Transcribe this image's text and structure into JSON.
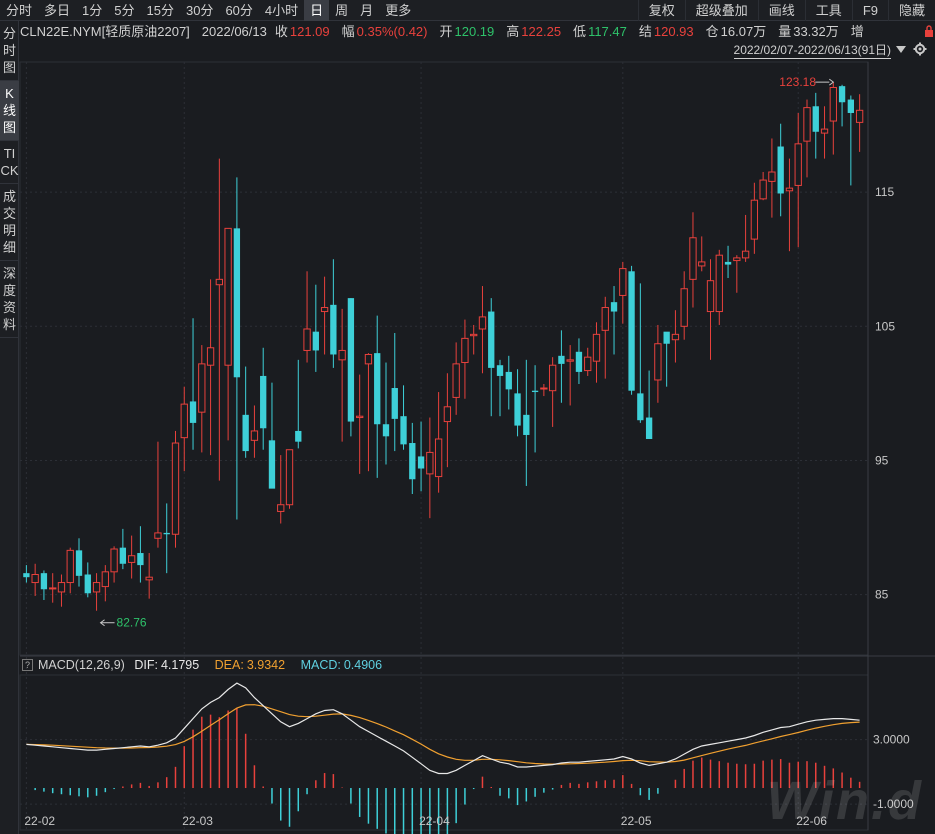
{
  "toolbar": {
    "periods": [
      "分时",
      "多日",
      "1分",
      "5分",
      "15分",
      "30分",
      "60分",
      "4小时",
      "日",
      "周",
      "月",
      "更多"
    ],
    "active_period": "日",
    "right_buttons": [
      "复权",
      "超级叠加",
      "画线",
      "工具",
      "F9",
      "隐藏"
    ]
  },
  "side_tabs": [
    {
      "label": "分时图",
      "active": false
    },
    {
      "label": "K线图",
      "active": true
    },
    {
      "label": "TICK",
      "active": false
    },
    {
      "label": "成交明细",
      "active": false
    },
    {
      "label": "深度资料",
      "active": false
    }
  ],
  "info": {
    "symbol": "CLN22E.NYM[轻质原油2207]",
    "date": "2022/06/13",
    "close_label": "收",
    "close": "121.09",
    "change_label": "幅",
    "change": "0.35%(0.42)",
    "open_label": "开",
    "open": "120.19",
    "high_label": "高",
    "high": "122.25",
    "low_label": "低",
    "low": "117.47",
    "settle_label": "结",
    "settle": "120.93",
    "oi_label": "仓",
    "oi": "16.07万",
    "vol_label": "量",
    "vol": "33.32万",
    "inc_label": "增"
  },
  "date_range": "2022/02/07-2022/06/13(91日)",
  "macd": {
    "title": "MACD(12,26,9)",
    "dif_label": "DIF:",
    "dif": "4.1795",
    "dea_label": "DEA:",
    "dea": "3.9342",
    "macd_label": "MACD:",
    "macd": "0.4906"
  },
  "watermark": "Win.d",
  "colors": {
    "up": "#e8413c",
    "down": "#3ed0d8",
    "dif": "#e8e8e8",
    "dea": "#f0a030",
    "bg": "#1a1c20",
    "grid": "#2c2f36"
  },
  "chart_data": {
    "type": "candlestick",
    "price_axis_ticks": [
      85,
      95,
      105,
      115
    ],
    "price_range": [
      80.5,
      124.7
    ],
    "max_label": "123.18",
    "min_label": "82.76",
    "macd_axis_ticks": [
      "3.0000",
      "-1.0000"
    ],
    "date_ticks": [
      {
        "label": "22-02",
        "index": 0
      },
      {
        "label": "22-03",
        "index": 18
      },
      {
        "label": "22-04",
        "index": 45
      },
      {
        "label": "22-05",
        "index": 68
      },
      {
        "label": "22-06",
        "index": 88
      }
    ],
    "candles": [
      [
        86.6,
        87.2,
        85.9,
        86.3
      ],
      [
        85.9,
        87.3,
        84.9,
        86.5
      ],
      [
        86.6,
        86.8,
        84.6,
        85.4
      ],
      [
        85.5,
        86.6,
        84.4,
        85.5
      ],
      [
        85.2,
        86.5,
        84.1,
        85.9
      ],
      [
        85.9,
        88.5,
        85.1,
        88.3
      ],
      [
        88.3,
        89.2,
        85.6,
        86.4
      ],
      [
        86.5,
        87.4,
        84.8,
        85.1
      ],
      [
        85.2,
        86.6,
        83.8,
        85.9
      ],
      [
        85.6,
        87.2,
        84.5,
        86.7
      ],
      [
        86.7,
        88.6,
        85.9,
        88.4
      ],
      [
        88.5,
        89.9,
        86.9,
        87.3
      ],
      [
        87.4,
        89.4,
        86.2,
        87.9
      ],
      [
        88.1,
        90.1,
        85.9,
        87.2
      ],
      [
        86.1,
        88.1,
        84.7,
        86.3
      ],
      [
        89.2,
        96.4,
        88.5,
        89.6
      ],
      [
        89.6,
        91.8,
        86.6,
        89.5
      ],
      [
        89.5,
        97.2,
        88.5,
        96.3
      ],
      [
        96.7,
        100.5,
        94.2,
        99.2
      ],
      [
        99.4,
        105.6,
        95.8,
        97.8
      ],
      [
        98.6,
        103.6,
        95.6,
        102.2
      ],
      [
        102.1,
        108.5,
        95.4,
        103.4
      ],
      [
        108.1,
        117.5,
        93.5,
        108.5
      ],
      [
        102.1,
        112.3,
        96.5,
        112.3
      ],
      [
        112.3,
        116.1,
        90.6,
        101.2
      ],
      [
        98.4,
        102.0,
        95.2,
        95.7
      ],
      [
        96.5,
        99.1,
        95.2,
        97.2
      ],
      [
        101.3,
        103.4,
        95.8,
        97.4
      ],
      [
        96.5,
        100.8,
        93.7,
        92.9
      ],
      [
        91.2,
        95.4,
        90.3,
        91.7
      ],
      [
        91.7,
        95.4,
        91.4,
        95.8
      ],
      [
        97.2,
        102.5,
        95.9,
        96.4
      ],
      [
        103.2,
        109.1,
        102.3,
        104.8
      ],
      [
        104.6,
        108.1,
        101.6,
        103.2
      ],
      [
        106.1,
        108.7,
        102.9,
        106.4
      ],
      [
        106.6,
        110.0,
        101.9,
        102.9
      ],
      [
        102.5,
        106.3,
        96.4,
        103.2
      ],
      [
        107.1,
        107.1,
        96.8,
        97.9
      ],
      [
        98.2,
        101.4,
        94.0,
        98.3
      ],
      [
        102.2,
        103.0,
        94.2,
        102.9
      ],
      [
        103.0,
        105.8,
        93.7,
        97.7
      ],
      [
        97.7,
        102.3,
        94.7,
        96.8
      ],
      [
        100.4,
        104.5,
        95.7,
        98.1
      ],
      [
        98.3,
        100.6,
        95.8,
        96.2
      ],
      [
        96.3,
        97.8,
        92.5,
        93.6
      ],
      [
        95.3,
        97.9,
        92.7,
        94.4
      ],
      [
        94.0,
        98.2,
        90.7,
        95.6
      ],
      [
        93.8,
        100.1,
        92.6,
        96.6
      ],
      [
        97.9,
        101.5,
        94.5,
        99.0
      ],
      [
        99.7,
        103.8,
        98.4,
        102.2
      ],
      [
        102.3,
        105.5,
        99.6,
        104.1
      ],
      [
        104.3,
        105.1,
        102.9,
        104.4
      ],
      [
        104.8,
        108.0,
        101.5,
        105.7
      ],
      [
        106.1,
        107.1,
        98.3,
        101.9
      ],
      [
        102.1,
        102.5,
        98.3,
        101.3
      ],
      [
        101.6,
        102.8,
        98.8,
        100.3
      ],
      [
        100.0,
        101.8,
        96.8,
        97.6
      ],
      [
        98.4,
        102.5,
        93.1,
        96.9
      ],
      [
        100.2,
        102.1,
        95.6,
        100.1
      ],
      [
        100.4,
        100.7,
        99.8,
        100.4
      ],
      [
        100.2,
        102.7,
        97.5,
        102.1
      ],
      [
        102.8,
        104.7,
        99.3,
        102.2
      ],
      [
        102.4,
        103.6,
        99.1,
        102.5
      ],
      [
        103.1,
        104.1,
        100.7,
        101.6
      ],
      [
        101.7,
        103.4,
        101.3,
        102.7
      ],
      [
        102.4,
        105.3,
        100.8,
        104.4
      ],
      [
        104.7,
        107.2,
        101.1,
        106.4
      ],
      [
        106.8,
        108.0,
        102.9,
        106.1
      ],
      [
        107.3,
        109.8,
        105.2,
        109.3
      ],
      [
        109.1,
        109.5,
        99.9,
        100.2
      ],
      [
        100.0,
        108.2,
        97.8,
        98.0
      ],
      [
        98.2,
        101.7,
        97.6,
        96.6
      ],
      [
        101.0,
        105.1,
        99.3,
        103.7
      ],
      [
        104.6,
        104.4,
        100.5,
        103.7
      ],
      [
        104.0,
        106.2,
        102.3,
        104.4
      ],
      [
        105.0,
        109.1,
        104.0,
        107.8
      ],
      [
        108.5,
        113.5,
        106.4,
        111.6
      ],
      [
        109.5,
        111.7,
        109.1,
        109.8
      ],
      [
        106.1,
        110.0,
        102.5,
        108.4
      ],
      [
        106.1,
        110.7,
        105.1,
        110.3
      ],
      [
        109.8,
        111.0,
        108.6,
        109.6
      ],
      [
        109.9,
        110.3,
        107.5,
        110.1
      ],
      [
        110.1,
        113.3,
        109.8,
        110.6
      ],
      [
        111.5,
        115.7,
        110.4,
        114.4
      ],
      [
        114.5,
        116.5,
        114.4,
        115.9
      ],
      [
        115.8,
        119.0,
        113.1,
        116.5
      ],
      [
        118.4,
        120.1,
        113.2,
        114.9
      ],
      [
        115.1,
        117.5,
        110.6,
        115.3
      ],
      [
        115.5,
        120.9,
        110.9,
        118.6
      ],
      [
        118.8,
        121.9,
        116.1,
        121.3
      ],
      [
        121.4,
        122.4,
        117.5,
        119.5
      ],
      [
        119.4,
        121.4,
        117.5,
        119.7
      ],
      [
        120.3,
        123.2,
        117.8,
        122.8
      ],
      [
        122.9,
        123.0,
        119.9,
        121.7
      ],
      [
        121.9,
        122.2,
        115.5,
        120.9
      ],
      [
        120.2,
        122.3,
        118.0,
        121.1
      ]
    ],
    "dif": [
      2.7,
      2.65,
      2.6,
      2.55,
      2.5,
      2.45,
      2.4,
      2.35,
      2.35,
      2.4,
      2.45,
      2.5,
      2.55,
      2.6,
      2.55,
      2.65,
      2.8,
      3.1,
      3.7,
      4.3,
      4.9,
      5.3,
      5.6,
      6.1,
      6.5,
      6.2,
      5.6,
      5.1,
      4.6,
      4.1,
      3.8,
      4.0,
      4.3,
      4.6,
      4.8,
      4.85,
      4.6,
      4.2,
      3.8,
      3.5,
      3.2,
      2.9,
      2.6,
      2.3,
      1.9,
      1.5,
      1.1,
      0.9,
      0.9,
      1.1,
      1.4,
      1.7,
      2.0,
      1.8,
      1.6,
      1.5,
      1.3,
      1.3,
      1.35,
      1.4,
      1.45,
      1.55,
      1.6,
      1.6,
      1.65,
      1.7,
      1.75,
      1.8,
      1.95,
      1.8,
      1.55,
      1.4,
      1.5,
      1.6,
      1.8,
      2.1,
      2.4,
      2.6,
      2.7,
      2.8,
      2.9,
      3.0,
      3.1,
      3.25,
      3.45,
      3.6,
      3.75,
      3.8,
      3.95,
      4.1,
      4.2,
      4.25,
      4.3,
      4.3,
      4.25,
      4.2
    ],
    "dea": [
      2.7,
      2.69,
      2.67,
      2.65,
      2.62,
      2.59,
      2.56,
      2.53,
      2.5,
      2.48,
      2.47,
      2.47,
      2.48,
      2.5,
      2.51,
      2.54,
      2.59,
      2.69,
      2.89,
      3.17,
      3.52,
      3.88,
      4.23,
      4.6,
      4.95,
      5.15,
      5.16,
      5.07,
      4.9,
      4.73,
      4.55,
      4.45,
      4.42,
      4.45,
      4.51,
      4.58,
      4.59,
      4.5,
      4.36,
      4.19,
      3.99,
      3.78,
      3.54,
      3.3,
      3.02,
      2.72,
      2.4,
      2.12,
      1.92,
      1.78,
      1.72,
      1.72,
      1.78,
      1.78,
      1.75,
      1.7,
      1.63,
      1.56,
      1.52,
      1.49,
      1.48,
      1.49,
      1.5,
      1.52,
      1.54,
      1.57,
      1.6,
      1.64,
      1.7,
      1.72,
      1.69,
      1.63,
      1.61,
      1.6,
      1.64,
      1.73,
      1.87,
      2.01,
      2.15,
      2.28,
      2.41,
      2.53,
      2.64,
      2.78,
      2.92,
      3.05,
      3.19,
      3.31,
      3.44,
      3.58,
      3.71,
      3.82,
      3.92,
      4.0,
      4.05,
      4.08
    ]
  }
}
